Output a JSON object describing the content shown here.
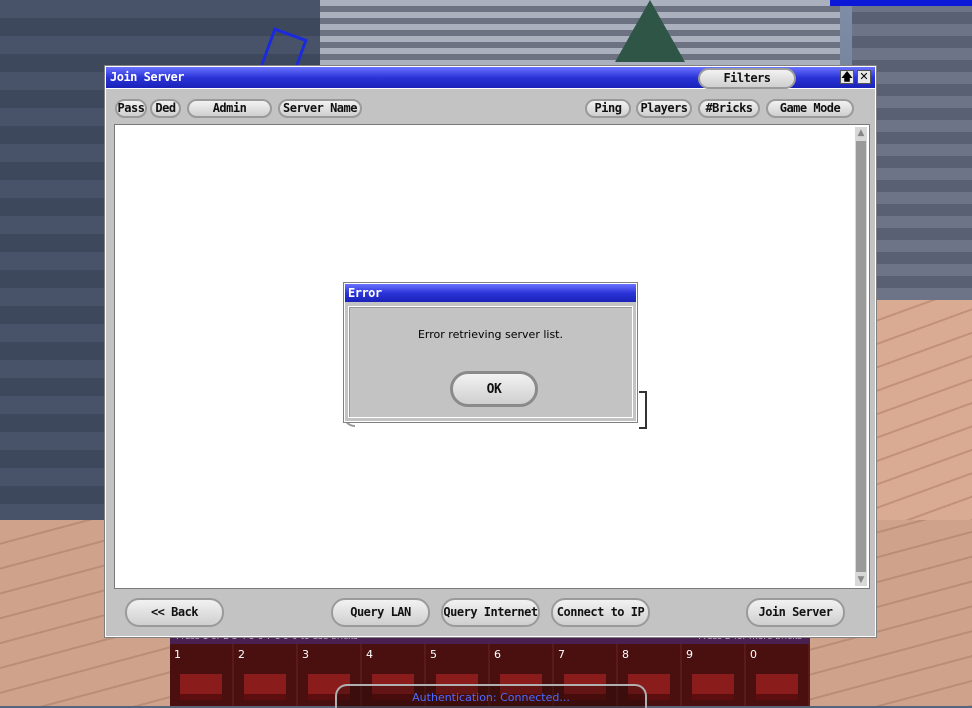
{
  "window": {
    "title": "Join Server",
    "filters_label": "Filters",
    "maximize_glyph": "🡅",
    "close_glyph": "✕"
  },
  "columns": {
    "pass": "Pass",
    "ded": "Ded",
    "admin": "Admin",
    "server_name": "Server Name",
    "ping": "Ping",
    "players": "Players",
    "bricks": "#Bricks",
    "game_mode": "Game Mode"
  },
  "buttons": {
    "back": "<< Back",
    "query_lan": "Query LAN",
    "query_internet": "Query Internet",
    "connect_ip": "Connect to IP",
    "join_server": "Join Server"
  },
  "dialog": {
    "title": "Error",
    "message": "Error retrieving server list.",
    "ok_label": "OK"
  },
  "brickbar": {
    "hint_left": "Press 1 or 2 3 4 5 6 7 8 9 0 to use bricks",
    "hint_right": "Press B for more bricks",
    "slots": [
      "1",
      "2",
      "3",
      "4",
      "5",
      "6",
      "7",
      "8",
      "9",
      "0"
    ]
  },
  "status": {
    "auth": "Authentication: Connected..."
  },
  "colors": {
    "titlebar": "#2b34d8",
    "window_bg": "#c3c3c3",
    "auth_text": "#4a6aff"
  }
}
